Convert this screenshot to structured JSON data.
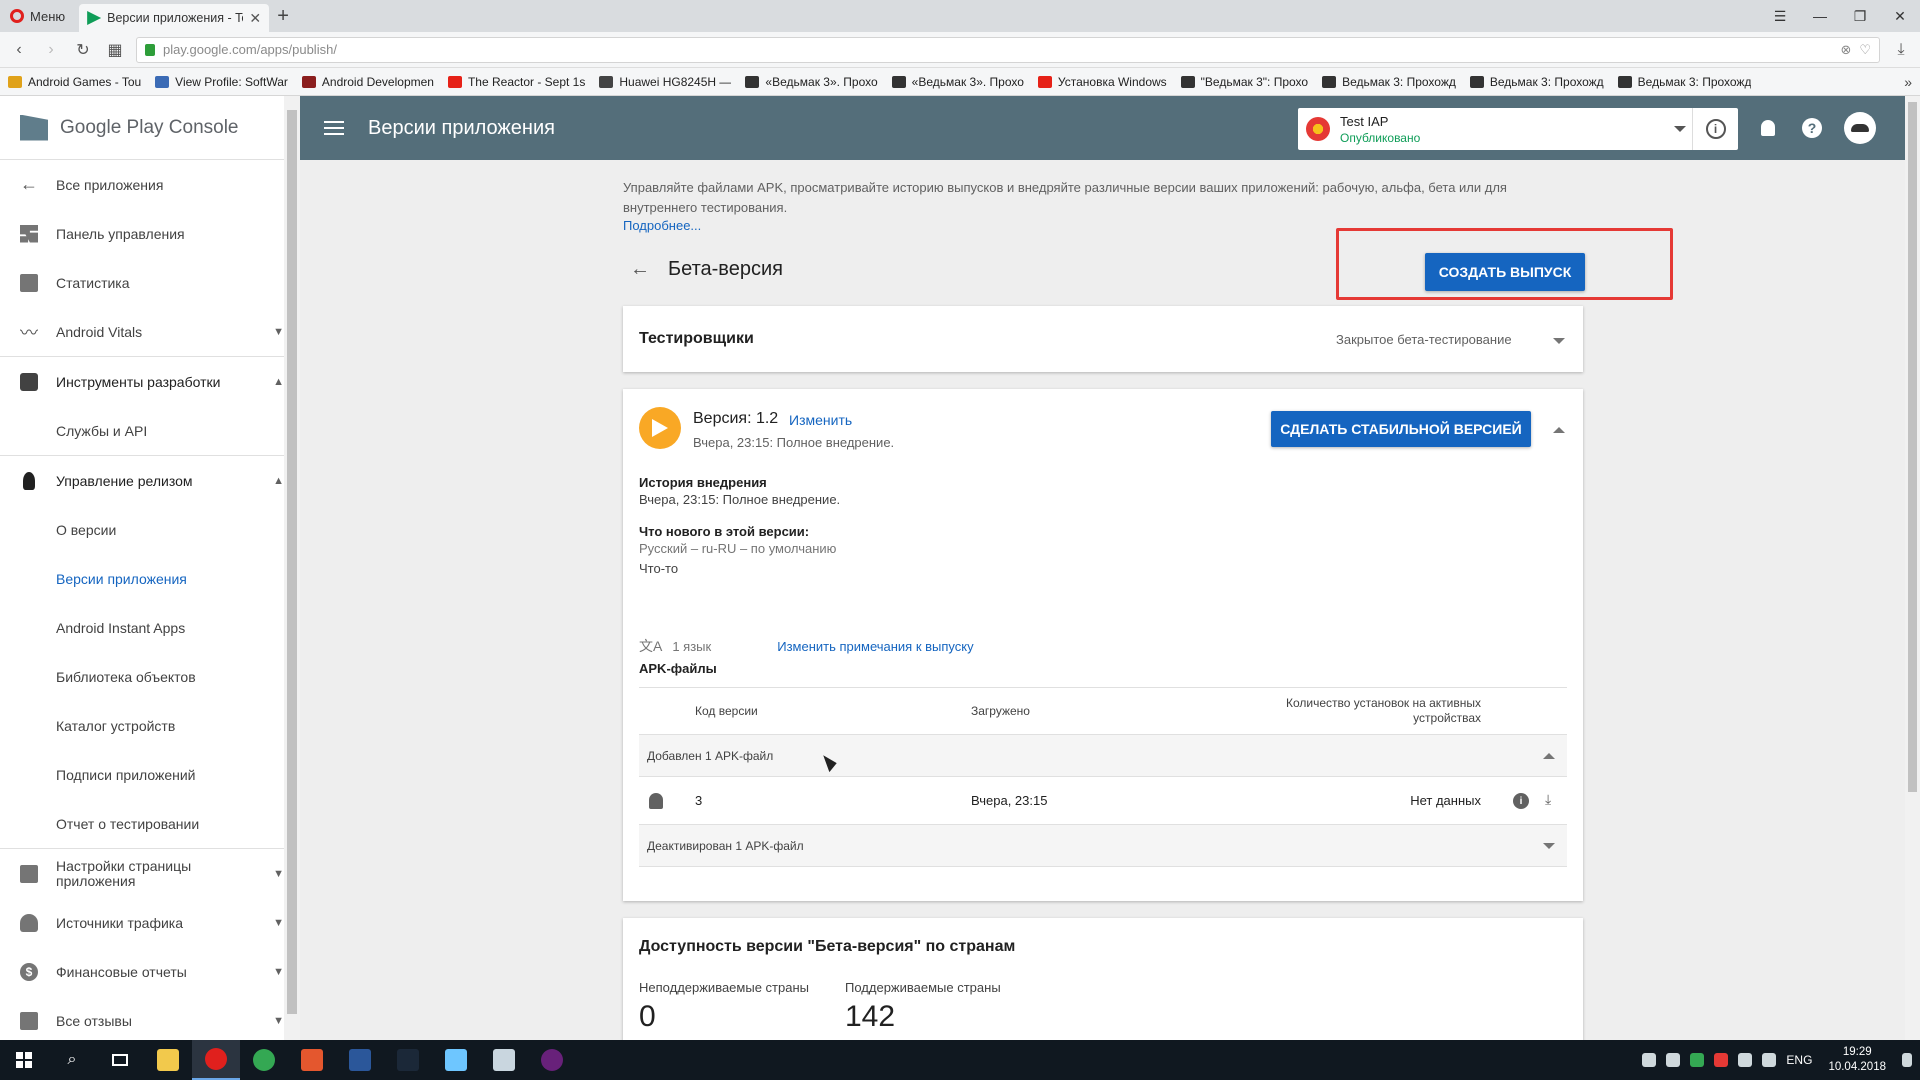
{
  "browser": {
    "menu_label": "Меню",
    "tab_title": "Версии приложения - Te:",
    "new_tab": "+",
    "url": "play.google.com/apps/publish/",
    "bookmarks": [
      {
        "label": "Android Games - Tou",
        "color": "#e0a21a"
      },
      {
        "label": "View Profile: SoftWar",
        "color": "#3b6bb5"
      },
      {
        "label": "Android Developmen",
        "color": "#8b1e1e"
      },
      {
        "label": "The Reactor - Sept 1s",
        "color": "#e62117"
      },
      {
        "label": "Huawei HG8245H —",
        "color": "#444444"
      },
      {
        "label": "«Ведьмак 3». Прохо",
        "color": "#333333"
      },
      {
        "label": "«Ведьмак 3». Прохо",
        "color": "#333333"
      },
      {
        "label": "Установка Windows",
        "color": "#e62117"
      },
      {
        "label": "\"Ведьмак 3\": Прохо",
        "color": "#333333"
      },
      {
        "label": "Ведьмак 3: Прохожд",
        "color": "#333333"
      },
      {
        "label": "Ведьмак 3: Прохожд",
        "color": "#333333"
      },
      {
        "label": "Ведьмак 3: Прохожд",
        "color": "#333333"
      }
    ],
    "bookmarks_more": "»"
  },
  "header": {
    "title": "Версии приложения",
    "app_name": "Test IAP",
    "app_status": "Опубликовано",
    "info_label": "i",
    "help_label": "?"
  },
  "sidebar": {
    "logo_text": "Google Play Console",
    "items": [
      {
        "label": "Все приложения",
        "icon": "arrow-left-icon"
      },
      {
        "label": "Панель управления",
        "icon": "dashboard-icon"
      },
      {
        "label": "Статистика",
        "icon": "bar-chart-icon"
      },
      {
        "label": "Android Vitals",
        "icon": "pulse-icon"
      },
      {
        "label": "Инструменты разработки",
        "icon": "dev-tools-icon"
      },
      {
        "label": "Службы и API"
      },
      {
        "label": "Управление релизом",
        "icon": "rocket-icon"
      },
      {
        "label": "О версии"
      },
      {
        "label": "Версии приложения"
      },
      {
        "label": "Android Instant Apps"
      },
      {
        "label": "Библиотека объектов"
      },
      {
        "label": "Каталог устройств"
      },
      {
        "label": "Подписи приложений"
      },
      {
        "label": "Отчет о тестировании"
      },
      {
        "label": "Настройки страницы приложения",
        "icon": "store-listing-icon"
      },
      {
        "label": "Источники трафика",
        "icon": "user-acquisition-icon"
      },
      {
        "label": "Финансовые отчеты",
        "icon": "dollar-icon"
      },
      {
        "label": "Все отзывы",
        "icon": "reviews-icon"
      }
    ]
  },
  "main": {
    "intro": "Управляйте файлами APK, просматривайте историю выпусков и внедряйте различные версии ваших приложений: рабочую, альфа, бета или для внутреннего тестирования.",
    "more_link": "Подробнее...",
    "track_title": "Бета-версия",
    "create_release": "СОЗДАТЬ ВЫПУСК",
    "testers": {
      "title": "Тестировщики",
      "type": "Закрытое бета-тестирование"
    },
    "version": {
      "label": "Версия: 1.2",
      "edit": "Изменить",
      "subtitle": "Вчера, 23:15: Полное внедрение.",
      "stable_button": "СДЕЛАТЬ СТАБИЛЬНОЙ ВЕРСИЕЙ",
      "history_title": "История внедрения",
      "history_text": "Вчера, 23:15: Полное внедрение.",
      "whats_new_title": "Что нового в этой версии:",
      "whats_new_lang": "Русский – ru-RU – по умолчанию",
      "whats_new_text": "Что-то",
      "languages": "1 язык",
      "edit_notes": "Изменить примечания к выпуску",
      "apk_title": "APK-файлы",
      "columns": {
        "code": "Код версии",
        "uploaded": "Загружено",
        "installs": "Количество установок на активных устройствах"
      },
      "added_group": "Добавлен 1 APK-файл",
      "row": {
        "code": "3",
        "uploaded": "Вчера, 23:15",
        "installs": "Нет данных"
      },
      "deactivated_group": "Деактивирован 1 APK-файл"
    },
    "availability": {
      "title": "Доступность версии \"Бета-версия\" по странам",
      "unsupported_label": "Неподдерживаемые страны",
      "unsupported_count": "0",
      "supported_label": "Поддерживаемые страны",
      "supported_count": "142"
    }
  },
  "taskbar": {
    "apps": [
      {
        "name": "file-explorer-icon",
        "color": "#f2c94c"
      },
      {
        "name": "opera-icon",
        "color": "#e0201d"
      },
      {
        "name": "chrome-icon",
        "color": "#34a853"
      },
      {
        "name": "paint-icon",
        "color": "#e4572e"
      },
      {
        "name": "word-icon",
        "color": "#2b579a"
      },
      {
        "name": "steam-icon",
        "color": "#1b2838"
      },
      {
        "name": "notepad-icon",
        "color": "#6ec6ff"
      },
      {
        "name": "explorer-doc-icon",
        "color": "#c9d6df"
      },
      {
        "name": "visual-studio-icon",
        "color": "#68217a"
      }
    ],
    "language": "ENG",
    "time": "19:29",
    "date": "10.04.2018"
  }
}
